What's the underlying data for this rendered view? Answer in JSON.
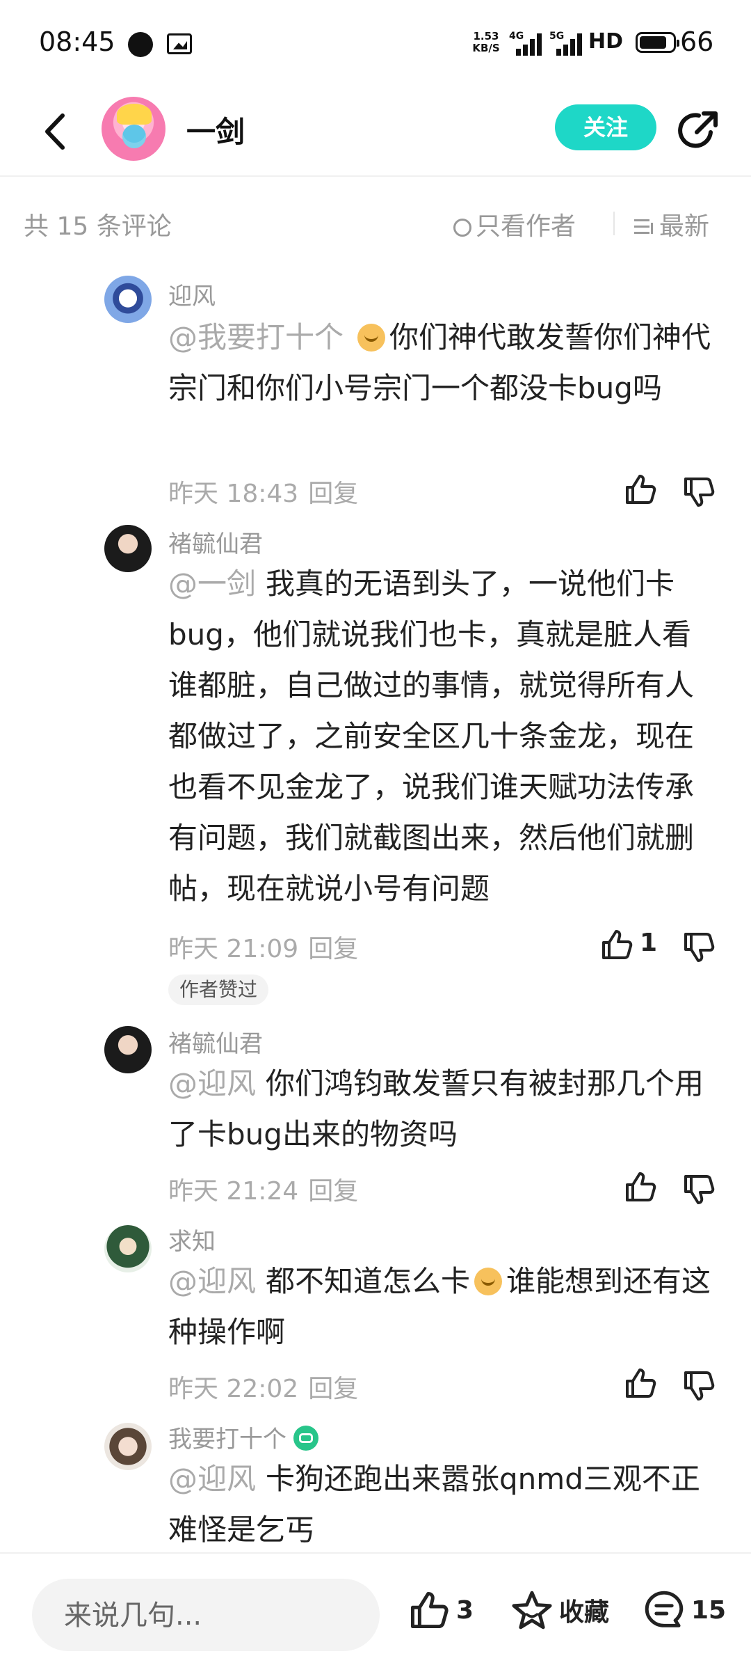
{
  "status_bar": {
    "time": "08:45",
    "net_speed_value": "1.53",
    "net_speed_unit": "KB/S",
    "signal_1_label": "4G",
    "signal_2_label": "5G",
    "hd_label": "HD",
    "battery": "66"
  },
  "header": {
    "author_name": "一剑",
    "follow_label": "关注"
  },
  "filter": {
    "count_label": "共 15 条评论",
    "only_author_label": "只看作者",
    "sort_label": "最新"
  },
  "comments": [
    {
      "user": "迎风",
      "mention": "@我要打十个",
      "text_before_emoji": "",
      "text": "你们神代敢发誓你们神代宗门和你们小号宗门一个都没卡bug吗",
      "time": "昨天 18:43",
      "reply_label": "回复",
      "likes": ""
    },
    {
      "user": "褚毓仙君",
      "mention": "@一剑",
      "text": "我真的无语到头了，一说他们卡bug，他们就说我们也卡，真就是脏人看谁都脏，自己做过的事情，就觉得所有人都做过了，之前安全区几十条金龙，现在也看不见金龙了，说我们谁天赋功法传承有问题，我们就截图出来，然后他们就删帖，现在就说小号有问题",
      "time": "昨天 21:09",
      "reply_label": "回复",
      "likes": "1",
      "author_liked_label": "作者赞过"
    },
    {
      "user": "褚毓仙君",
      "mention": "@迎风",
      "text": "你们鸿钧敢发誓只有被封那几个用了卡bug出来的物资吗",
      "time": "昨天 21:24",
      "reply_label": "回复",
      "likes": ""
    },
    {
      "user": "求知",
      "mention": "@迎风",
      "text_part1": "都不知道怎么卡",
      "text_part2": "谁能想到还有这种操作啊",
      "time": "昨天 22:02",
      "reply_label": "回复",
      "likes": ""
    },
    {
      "user": "我要打十个",
      "mention": "@迎风",
      "text": "卡狗还跑出来嚣张qnmd三观不正 难怪是乞丐"
    }
  ],
  "bottom_bar": {
    "input_placeholder": "来说几句...",
    "like_count": "3",
    "favorite_label": "收藏",
    "comment_count": "15"
  }
}
